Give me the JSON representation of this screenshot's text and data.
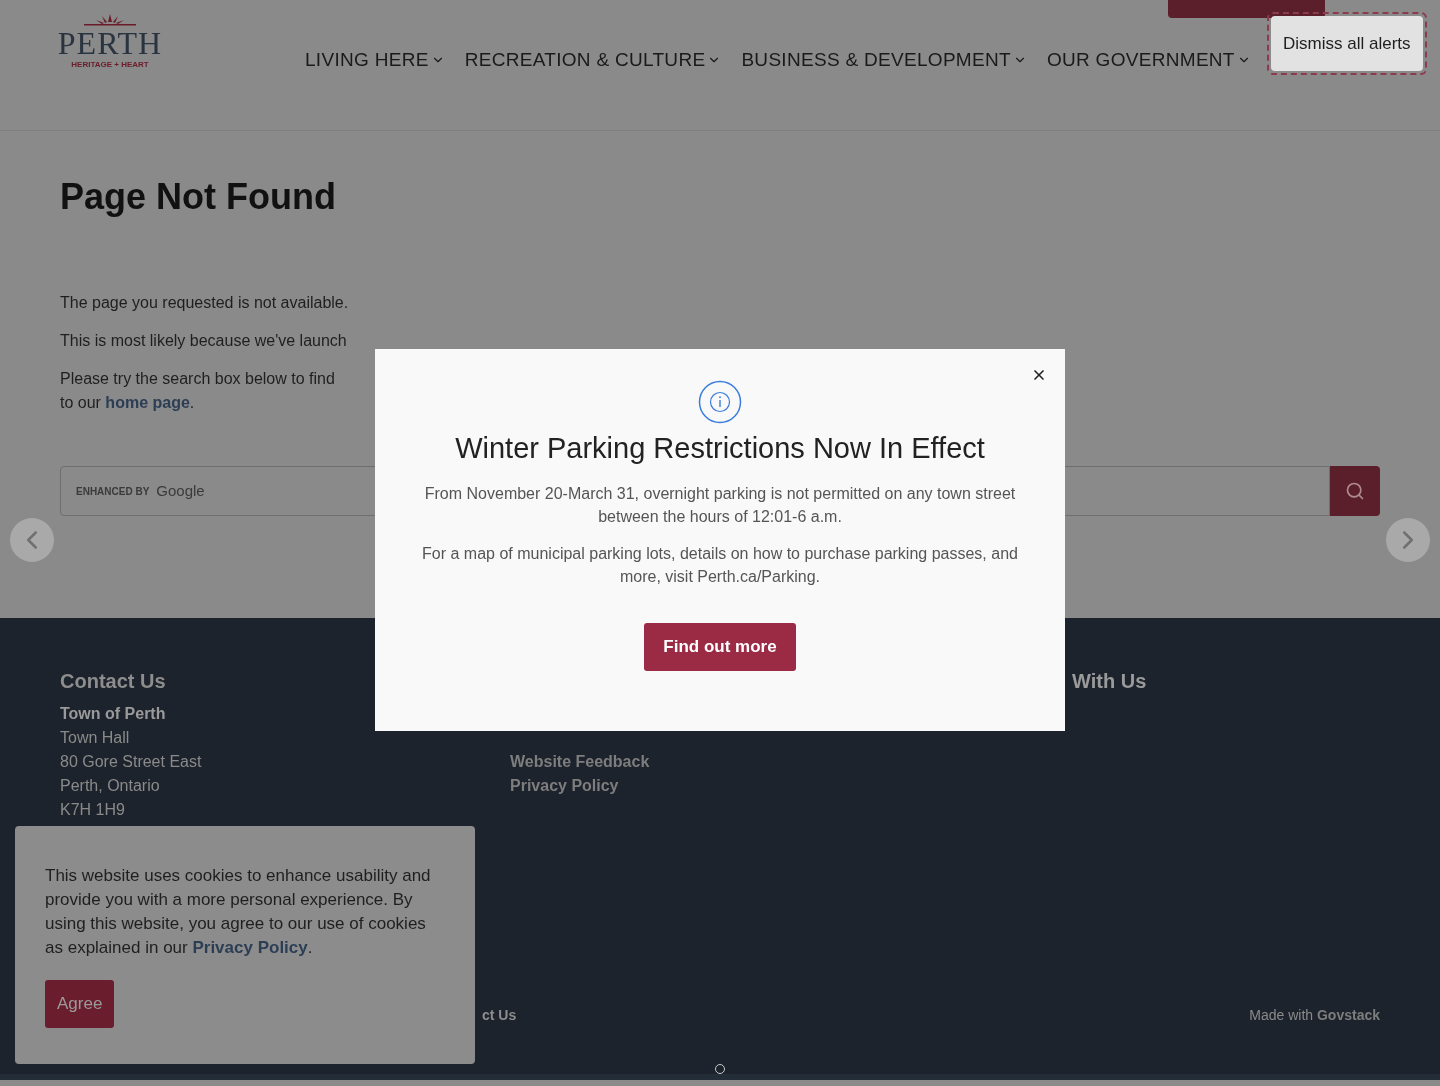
{
  "header": {
    "logo": {
      "name": "PERTH",
      "tagline": "HERITAGE + HEART"
    },
    "nav": [
      {
        "label": "LIVING HERE"
      },
      {
        "label": "RECREATION & CULTURE"
      },
      {
        "label": "BUSINESS & DEVELOPMENT"
      },
      {
        "label": "OUR GOVERNMENT"
      }
    ],
    "dismiss_alerts": "Dismiss all alerts"
  },
  "main": {
    "title": "Page Not Found",
    "paragraphs": [
      "The page you requested is not available.",
      "This is most likely because we've launch"
    ],
    "search_hint": {
      "first_line": "Please try the search box below to find",
      "before": "to our ",
      "link": "home page",
      "after": "."
    },
    "search": {
      "branding": "ENHANCED BY",
      "brand": "Google"
    }
  },
  "alert_modal": {
    "title": "Winter Parking Restrictions Now In Effect",
    "paragraphs": [
      "From November 20-March 31, overnight parking is not permitted on any town street between the hours of 12:01-6 a.m.",
      "For a map of municipal parking lots, details on how to purchase parking passes, and more, visit Perth.ca/Parking."
    ],
    "button": "Find out more"
  },
  "footer": {
    "contact": {
      "heading": "Contact Us",
      "lines": [
        {
          "text": "Town of Perth",
          "bold": true
        },
        {
          "text": "Town Hall",
          "bold": false
        },
        {
          "text": "80 Gore Street East",
          "bold": false
        },
        {
          "text": "Perth, Ontario",
          "bold": false
        },
        {
          "text": "K7H 1H9",
          "bold": false
        }
      ]
    },
    "links": [
      "Website Feedback",
      "Privacy Policy"
    ],
    "connect_heading": "With Us",
    "bottom_link": "ct Us",
    "credit": {
      "prefix": "Made with",
      "link": "Govstack"
    }
  },
  "cookie_banner": {
    "text": "This website uses cookies to enhance usability and provide you with a more personal experience. By using this website, you agree to our use of cookies as explained in our ",
    "link": "Privacy Policy",
    "after": ".",
    "button": "Agree"
  }
}
